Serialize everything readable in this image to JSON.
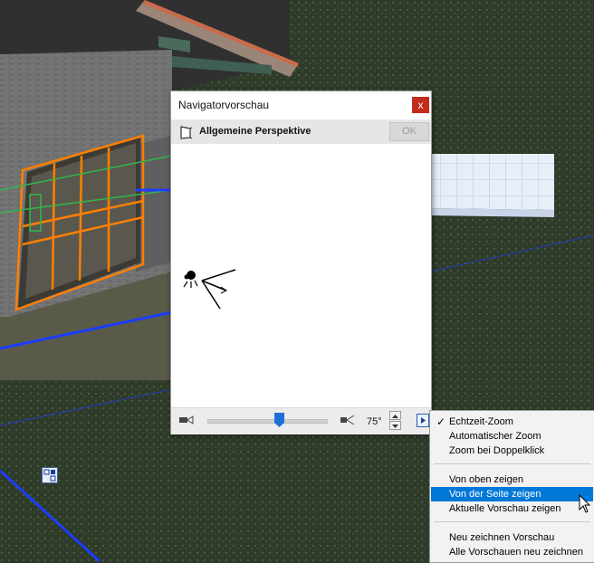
{
  "window": {
    "title": "Navigatorvorschau",
    "close_icon": "close-icon",
    "close_symbol": "x"
  },
  "view": {
    "label": "Allgemeine Perspektive",
    "ok_label": "OK",
    "icon": "perspective-view-icon"
  },
  "zoom": {
    "angle": "75°",
    "slider_value": 0.6
  },
  "menu": {
    "items": [
      {
        "label": "Echtzeit-Zoom",
        "checked": true
      },
      {
        "label": "Automatischer Zoom"
      },
      {
        "label": "Zoom bei Doppelklick"
      },
      {
        "label": "Von oben zeigen"
      },
      {
        "label": "Von der Seite zeigen",
        "highlighted": true
      },
      {
        "label": "Aktuelle Vorschau zeigen"
      },
      {
        "label": "Neu zeichnen Vorschau"
      },
      {
        "label": "Alle Vorschauen neu zeichnen"
      }
    ],
    "check_symbol": "✓"
  },
  "colors": {
    "highlight": "#0078d7",
    "close": "#c42b1c",
    "selection": "#ff7f00",
    "grid": "#1a3dff"
  }
}
